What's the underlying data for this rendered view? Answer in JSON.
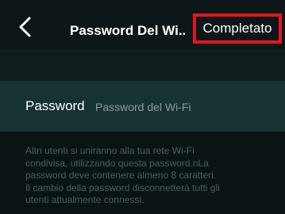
{
  "nav": {
    "title": "Password Del Wi..",
    "done_label": "Completato",
    "back_icon": "chevron-left-icon",
    "highlight_color": "#e8131c"
  },
  "form": {
    "label": "Password",
    "placeholder": "Password del Wi-Fi",
    "value": ""
  },
  "help": {
    "lines": [
      "Altri utenti si uniranno alla tua rete Wi-Fi",
      "condivisa, utilizzando questa password.nLa",
      "password deve contenere almeno 8 caratteri.",
      "Il cambio della password disconnetterà tutti gli",
      "utenti attualmente connessi."
    ]
  }
}
